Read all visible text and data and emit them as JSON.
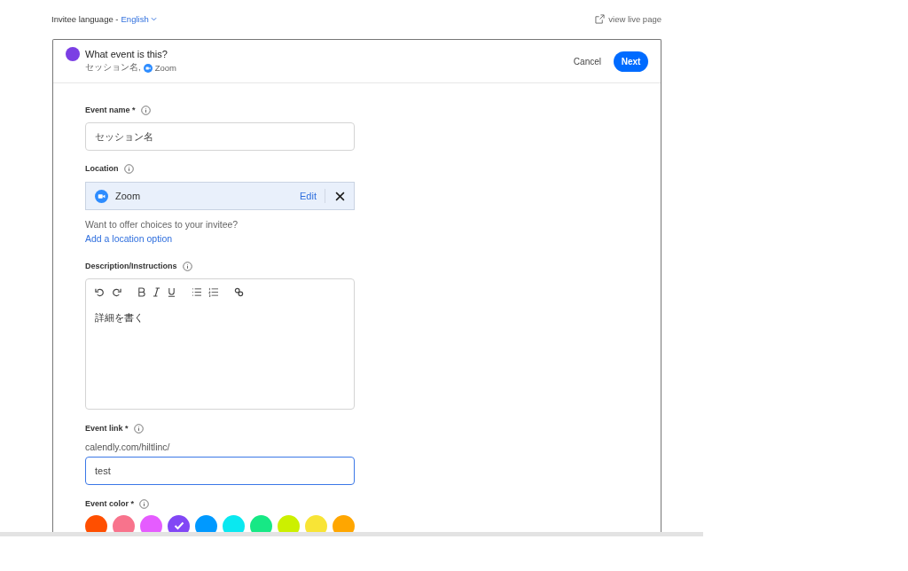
{
  "top_bar": {
    "language_label": "Invitee language -",
    "language": "English",
    "view_live_page": "view live page"
  },
  "header": {
    "title": "What event is this?",
    "subtitle_name": "セッション名,",
    "subtitle_location": "Zoom",
    "color": "#7b3fe4",
    "cancel": "Cancel",
    "next": "Next"
  },
  "event_name": {
    "label": "Event name *",
    "value": "セッション名"
  },
  "location": {
    "label": "Location",
    "value": "Zoom",
    "edit": "Edit",
    "question": "Want to offer choices to your invitee?",
    "add_link": "Add a location option"
  },
  "description": {
    "label": "Description/Instructions",
    "value": "詳細を書く"
  },
  "event_link": {
    "label": "Event link *",
    "prefix": "calendly.com/hiltlinc/",
    "value": "test",
    "focused": true
  },
  "event_color": {
    "label": "Event color *",
    "swatches": [
      {
        "color": "#ff4f00",
        "selected": false
      },
      {
        "color": "#f8738c",
        "selected": false
      },
      {
        "color": "#e55cff",
        "selected": false
      },
      {
        "color": "#8247f5",
        "selected": true
      },
      {
        "color": "#0099ff",
        "selected": false
      },
      {
        "color": "#0ae8f0",
        "selected": false
      },
      {
        "color": "#17e885",
        "selected": false
      },
      {
        "color": "#ccf000",
        "selected": false
      },
      {
        "color": "#f8e436",
        "selected": false
      },
      {
        "color": "#ffa600",
        "selected": false
      }
    ]
  }
}
